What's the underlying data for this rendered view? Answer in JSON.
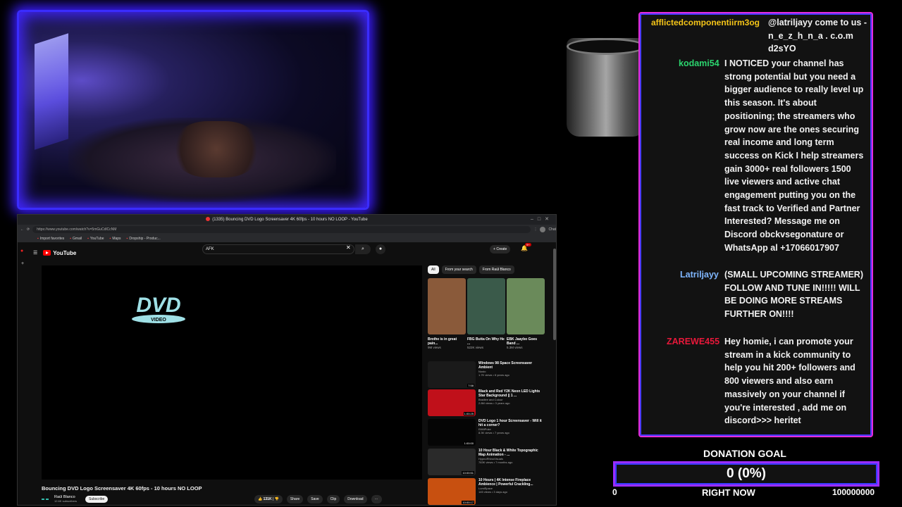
{
  "browser": {
    "tab_title": "(1335) Bouncing DVD Logo Screensaver 4K 60fps - 10 hours NO LOOP - YouTube",
    "url": "https://www.youtube.com/watch?v=5mGuCdlCcNM",
    "bookmarks": [
      "Import favorites",
      "Gmail",
      "YouTube",
      "Maps",
      "Dropship - Produc..."
    ],
    "profile_label": "Chat"
  },
  "youtube": {
    "logo": "YouTube",
    "search_value": "AFK",
    "create_label": "Create",
    "notif_count": "9+",
    "video": {
      "title": "Bouncing DVD Logo Screensaver 4K 60fps - 10 hours NO LOOP",
      "channel": "Raúl Blanco",
      "subscribers": "12.6K subscribers",
      "subscribe_label": "Subscribe",
      "likes": "131K",
      "actions": [
        "Share",
        "Save",
        "Clip",
        "Download"
      ]
    },
    "chips": [
      "All",
      "From your search",
      "From Raúl Blanco"
    ],
    "shorts": [
      {
        "title": "Brothe is in great pain...",
        "views": "9M views",
        "color": "#8a5a3a"
      },
      {
        "title": "FBG Butta On Why He ...",
        "views": "522K views",
        "color": "#3a5a4a"
      },
      {
        "title": "EBK Jaaybo Goes Band ...",
        "views": "5.3M views",
        "color": "#6a8a5a"
      }
    ],
    "recommended": [
      {
        "title": "Windows 98 Space Screensaver Ambient",
        "channel": "Nosto",
        "meta": "1.7K views • 6 years ago",
        "duration": "7:58",
        "color": "#1a1a1a"
      },
      {
        "title": "Black and Red Y2K Neon LED Lights Star Background || 1 ...",
        "channel": "Bradlee and Colour",
        "meta": "2.8M views • 3 years ago",
        "duration": "1:00:25",
        "color": "#c0101a"
      },
      {
        "title": "DVD Logo 1 hour Screensaver - Will it hit a corner?",
        "channel": "EliMiPuke",
        "meta": "8.3K views • 7 years ago",
        "duration": "1:00:00",
        "color": "#050505"
      },
      {
        "title": "10 Hour Black & White Topographic Map Animation - ...",
        "channel": "HypnoRhinoVisuals",
        "meta": "783K views • 7 months ago",
        "duration": "10:00:51",
        "color": "#2a2a2a"
      },
      {
        "title": "10 Hours | 4K Intense Fireplace Ambience | Powerful Crackling...",
        "channel": "LumiSpace",
        "meta": "145 views • 3 days ago",
        "duration": "10:00:17",
        "color": "#c85010"
      }
    ]
  },
  "chat": {
    "messages": [
      {
        "user": "afflictedcomponentiirm3og",
        "color": "#f5c518",
        "text": "@latriljayy come to us - n_e_z_h_n_a . c.o.m d2sYO"
      },
      {
        "user": "kodami54",
        "color": "#2bd46e",
        "text": "I NOTICED your channel has strong potential but you need a bigger audience to really level up this season. It's about positioning; the streamers who grow now are the ones securing real income and long term success on Kick I help streamers gain 3000+ real followers 1500 live viewers and active chat engagement putting you on the fast track to Verified and Partner Interested? Message me on Discord obckvsegonature or WhatsApp al +17066017907"
      },
      {
        "user": "Latriljayy",
        "color": "#7fb6ff",
        "text": "(SMALL UPCOMING STREAMER) FOLLOW AND TUNE IN!!!!! WILL BE DOING MORE STREAMS FURTHER ON!!!!"
      },
      {
        "user": "ZAREWE455",
        "color": "#e8183a",
        "text": "Hey homie, i can promote your stream in a kick community to help you hit 200+ followers and 800 viewers and also earn massively on your channel if you're interested , add me on discord>>> heritet"
      }
    ]
  },
  "donation": {
    "title": "DONATION GOAL",
    "amount": "0 (0%)",
    "min": "0",
    "status": "RIGHT NOW",
    "goal": "100000000",
    "progress": 0
  }
}
